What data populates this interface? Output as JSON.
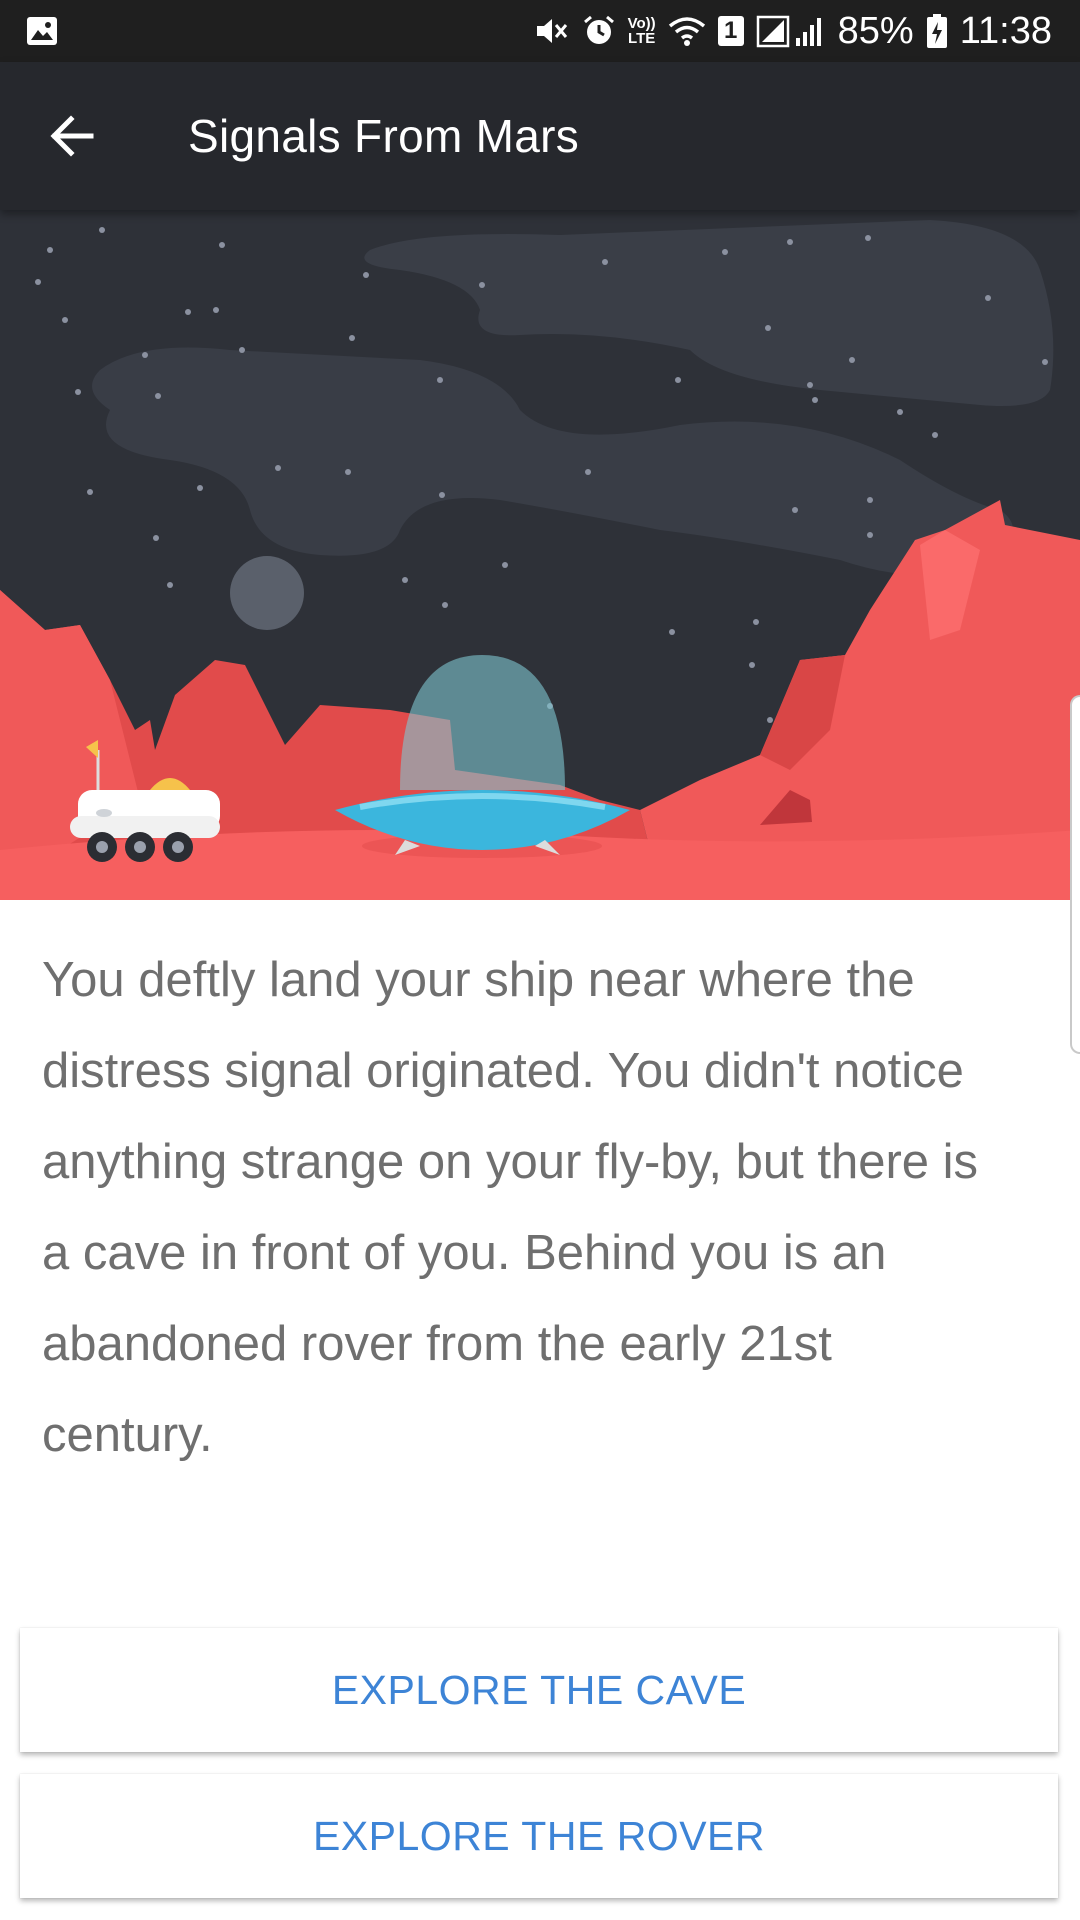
{
  "status_bar": {
    "battery": "85%",
    "time": "11:38",
    "sim_slot": "1",
    "volte_top": "Vo))",
    "volte_bottom": "LTE",
    "icons": [
      "gallery-icon",
      "mute-icon",
      "alarm-icon",
      "volte-icon",
      "wifi-icon",
      "sim-icon",
      "signal-icon",
      "battery-icon"
    ]
  },
  "app_bar": {
    "title": "Signals From Mars",
    "back_icon": "arrow-back-icon"
  },
  "story": {
    "text": "You deftly land your ship near where the distress signal originated. You didn't notice anything strange on your fly-by, but there is a cave in front of you. Behind you is an abandoned rover from the early 21st century."
  },
  "choices": [
    {
      "label": "EXPLORE THE CAVE"
    },
    {
      "label": "EXPLORE THE ROVER"
    }
  ],
  "colors": {
    "status_bar": "#1f1f1f",
    "app_bar": "#26282d",
    "sky": "#2e3138",
    "mars_ground": "#f45d5d",
    "button_text": "#3d84d6",
    "story_text": "#6f6f6f"
  }
}
